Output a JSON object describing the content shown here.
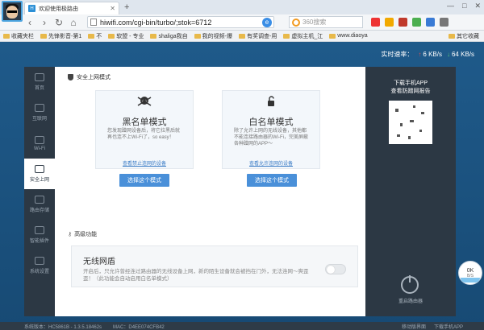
{
  "browser": {
    "tab_title": "欢迎使用极路由",
    "tab_fav": "H",
    "new_tab": "+",
    "url": "hiwifi.com/cgi-bin/turbo/;stok=6712",
    "search_placeholder": "360搜索",
    "window_controls": [
      "—",
      "□",
      "✕"
    ]
  },
  "bookmarks": [
    {
      "label": "收藏夹栏"
    },
    {
      "label": "先锋影音-第1"
    },
    {
      "label": "不"
    },
    {
      "label": "软盟 - 专业"
    },
    {
      "label": "shaliga我自"
    },
    {
      "label": "我的视频-爆"
    },
    {
      "label": "有奖调查-用"
    },
    {
      "label": "虚拟主机_江"
    },
    {
      "label": "www.diaoya"
    }
  ],
  "bookmarks_other": "其它收藏",
  "speed": {
    "label": "实时速率：",
    "upload": "6 KB/s",
    "download": "64 KB/s"
  },
  "nav": [
    {
      "label": "首页"
    },
    {
      "label": "互联网"
    },
    {
      "label": "Wi-Fi"
    },
    {
      "label": "安全上网",
      "active": true
    },
    {
      "label": "路由存储"
    },
    {
      "label": "智能插件"
    },
    {
      "label": "系统设置"
    }
  ],
  "security": {
    "title": "安全上网模式",
    "blacklist": {
      "name": "黑名单模式",
      "desc": "您发现蹭网设备后，将它拉黑后就再也连不上Wi-Fi了，so easy！",
      "link": "查看禁止连网的设备",
      "button": "选择这个模式"
    },
    "whitelist": {
      "name": "白名单模式",
      "desc": "除了允许上网的无线设备，其他都不能连接路由器的Wi-Fi，完美屏蔽各种蹭网的APP～",
      "link": "查看允许连网的设备",
      "button": "选择这个模式"
    }
  },
  "advanced": {
    "title": "高级功能",
    "wired_title": "无线网盾",
    "wired_desc": "开启后，只允许曾经连过路由器的无线设备上网，新的陌生设备就会被挡在门外，无法连网～爽歪歪！（此功能会自动启用白名单模式）"
  },
  "right_panel": {
    "download_line1": "下载手机APP",
    "download_line2": "查看防蹭网报告",
    "reboot": "重启路由器"
  },
  "speedball": {
    "value": "0K",
    "unit": "B/S"
  },
  "footer": {
    "version": "系统版本：HC5861B - 1.3.5.18462s",
    "mac": "MAC：D4EE074CFB42",
    "mobile": "移动版界面",
    "app": "下载手机APP"
  }
}
